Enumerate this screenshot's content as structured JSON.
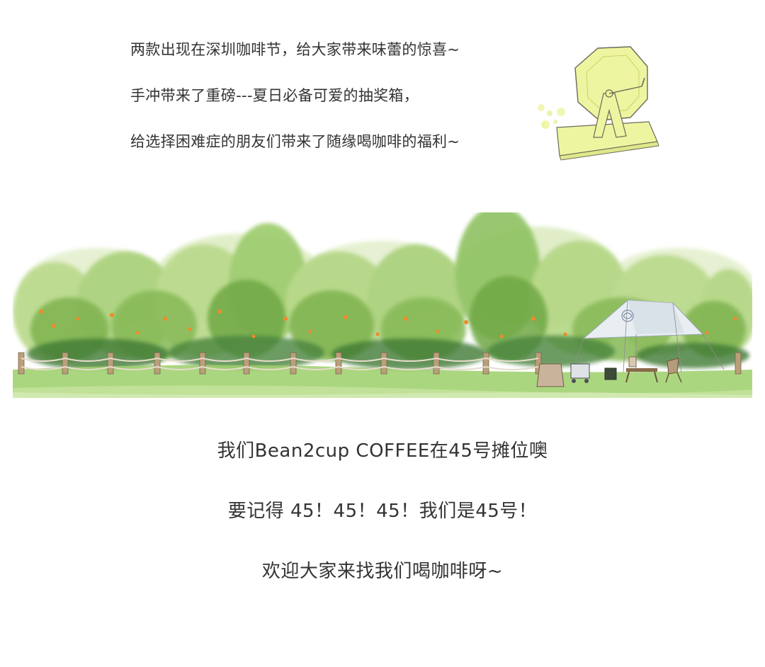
{
  "intro": {
    "line1": "两款出现在深圳咖啡节，给大家带来味蕾的惊喜~",
    "line2": "手冲带来了重磅---夏日必备可爱的抽奖箱，",
    "line3": "给选择困难症的朋友们带来了随缘喝咖啡的福利~"
  },
  "illustrations": {
    "lottery_box": "lottery-box-illustration",
    "scene": "tree-fence-tent-scene-illustration"
  },
  "colors": {
    "text": "#333333",
    "lottery_box_fill": "#eef5a0",
    "foliage_light": "#b9d98a",
    "foliage_mid": "#7fb34f",
    "foliage_dark": "#3f7a36",
    "orange_fruit": "#f08a2c",
    "grass": "#9ccf6a",
    "tent": "#e9eef3"
  },
  "closing": {
    "line1": "我们Bean2cup  COFFEE在45号摊位噢",
    "line2": "要记得 45！45！45！我们是45号！",
    "line3": "欢迎大家来找我们喝咖啡呀~"
  }
}
